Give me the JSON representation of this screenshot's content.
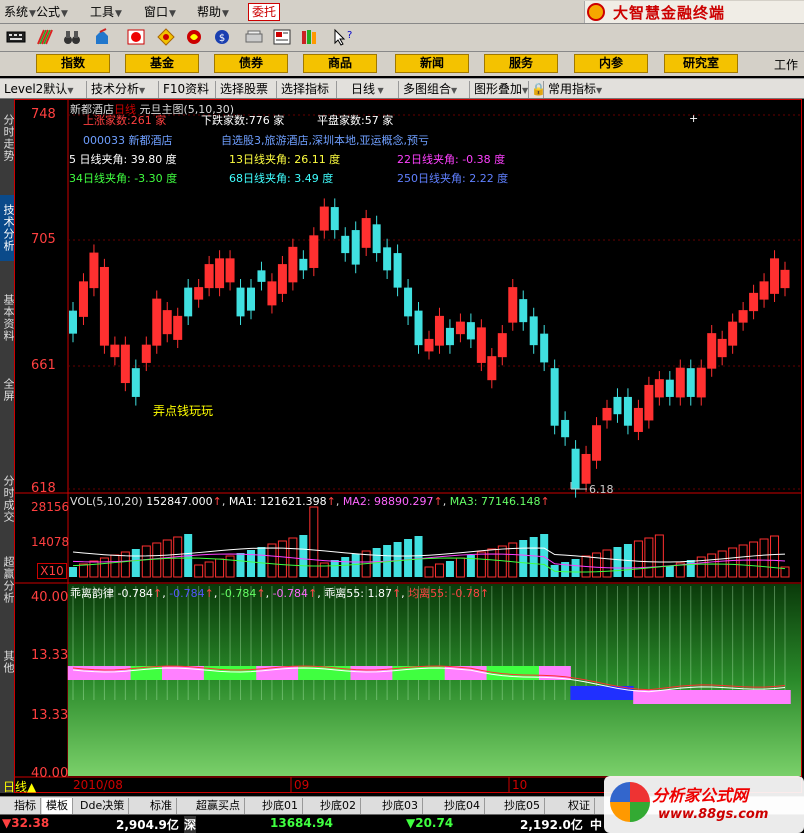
{
  "menubar": {
    "items": [
      "系统",
      "公式",
      "工具",
      "窗口",
      "帮助"
    ],
    "entrust": "委托",
    "brand": "大智慧金融终端"
  },
  "toolbar": {
    "icons": [
      "keyboard-icon",
      "stripes-icon",
      "binoculars-icon",
      "hand-icon",
      "alarm-icon",
      "diamond-icon",
      "swirl-icon",
      "dollar-icon",
      "scanner-icon",
      "news-icon",
      "books-icon",
      "help-pointer-icon"
    ]
  },
  "navbar": {
    "buttons": [
      "指数",
      "基金",
      "债券",
      "商品",
      "新闻",
      "服务",
      "内参",
      "研究室"
    ],
    "extra": "工作"
  },
  "chart_toolbar": {
    "items": [
      "Level2默认",
      "技术分析",
      "F10资料",
      "选择股票",
      "选择指标",
      "日线",
      "多图组合",
      "图形叠加",
      "常用指标"
    ]
  },
  "sidebar": {
    "tabs": [
      "分时走势",
      "技术分析",
      "基本资料",
      "全屏",
      "分时成交",
      "超赢分析",
      "其他"
    ]
  },
  "price_chart": {
    "title": "新都酒店",
    "period": "日线",
    "indicator": "元旦主图(5,10,30)",
    "up_count": "上涨家数:261 家",
    "down_count": "下跌家数:776 家",
    "flat_count": "平盘家数:57 家",
    "code_name": "000033 新都酒店",
    "tags": "自选股3,旅游酒店,深圳本地,亚运概念,预亏",
    "angles": [
      {
        "text": "5 日线夹角: 39.80 度",
        "color": "#ffffff"
      },
      {
        "text": "13日线夹角: 26.11 度",
        "color": "#ffff40"
      },
      {
        "text": "22日线夹角: -0.38 度",
        "color": "#ff40ff"
      },
      {
        "text": "34日线夹角: -3.30 度",
        "color": "#40ff40"
      },
      {
        "text": "68日线夹角: 3.49 度",
        "color": "#40ffff"
      },
      {
        "text": "250日线夹角: 2.22 度",
        "color": "#6080ff"
      }
    ],
    "note": "弄点钱玩玩",
    "low_mark": "6.18",
    "y_labels": [
      "748",
      "705",
      "661",
      "618"
    ]
  },
  "volume_chart": {
    "label": "VOL(5,10,20)",
    "vol": "152847.000",
    "ma1": "MA1: 121621.398",
    "ma2": "MA2: 98890.297",
    "ma3": "MA3: 77146.148",
    "y_labels": [
      "28156",
      "14078",
      "X10"
    ]
  },
  "indicator_chart": {
    "label": "乖离韵律",
    "v1": "-0.784",
    "v2": "-0.784",
    "v3": "-0.784",
    "v4": "-0.784",
    "v5": "乖离55: 1.87",
    "v6": "均离55: -0.78",
    "y_labels": [
      "40.00",
      "13.33",
      "13.33",
      "40.00"
    ]
  },
  "time_axis": {
    "labels": [
      "2010/08",
      "09",
      "10"
    ],
    "period_tab": "日线"
  },
  "bottom_tabs": [
    "指标",
    "模板",
    "Dde决策",
    "标准",
    "超赢买点",
    "抄底01",
    "抄底02",
    "抄底03",
    "抄底04",
    "抄底05",
    "权证"
  ],
  "status": {
    "s1": "32.38",
    "s2": "2,904.9亿",
    "s3": "深",
    "s4": "13684.94",
    "s5": "20.74",
    "s6": "2,192.0亿",
    "s7": "中"
  },
  "watermark": {
    "title": "分析家公式网",
    "url": "www.88gs.com"
  },
  "chart_data": {
    "type": "candlestick",
    "series": [
      {
        "o": 672,
        "c": 680,
        "up": false
      },
      {
        "o": 678,
        "c": 690,
        "up": true
      },
      {
        "o": 688,
        "c": 700,
        "up": true
      },
      {
        "o": 695,
        "c": 668,
        "up": true
      },
      {
        "o": 668,
        "c": 664,
        "up": true
      },
      {
        "o": 668,
        "c": 655,
        "up": true
      },
      {
        "o": 660,
        "c": 650,
        "up": false
      },
      {
        "o": 662,
        "c": 668,
        "up": true
      },
      {
        "o": 668,
        "c": 684,
        "up": true
      },
      {
        "o": 672,
        "c": 680,
        "up": true
      },
      {
        "o": 678,
        "c": 670,
        "up": true
      },
      {
        "o": 678,
        "c": 688,
        "up": false
      },
      {
        "o": 684,
        "c": 688,
        "up": true
      },
      {
        "o": 688,
        "c": 696,
        "up": true
      },
      {
        "o": 698,
        "c": 688,
        "up": true
      },
      {
        "o": 690,
        "c": 698,
        "up": true
      },
      {
        "o": 688,
        "c": 678,
        "up": false
      },
      {
        "o": 680,
        "c": 688,
        "up": false
      },
      {
        "o": 690,
        "c": 694,
        "up": false
      },
      {
        "o": 690,
        "c": 682,
        "up": true
      },
      {
        "o": 686,
        "c": 696,
        "up": true
      },
      {
        "o": 702,
        "c": 690,
        "up": true
      },
      {
        "o": 694,
        "c": 698,
        "up": false
      },
      {
        "o": 695,
        "c": 706,
        "up": true
      },
      {
        "o": 708,
        "c": 716,
        "up": true
      },
      {
        "o": 716,
        "c": 708,
        "up": false
      },
      {
        "o": 706,
        "c": 700,
        "up": false
      },
      {
        "o": 708,
        "c": 696,
        "up": false
      },
      {
        "o": 702,
        "c": 712,
        "up": true
      },
      {
        "o": 710,
        "c": 700,
        "up": false
      },
      {
        "o": 702,
        "c": 694,
        "up": false
      },
      {
        "o": 700,
        "c": 688,
        "up": false
      },
      {
        "o": 688,
        "c": 678,
        "up": false
      },
      {
        "o": 680,
        "c": 668,
        "up": false
      },
      {
        "o": 666,
        "c": 670,
        "up": true
      },
      {
        "o": 668,
        "c": 678,
        "up": true
      },
      {
        "o": 674,
        "c": 668,
        "up": false
      },
      {
        "o": 672,
        "c": 676,
        "up": true
      },
      {
        "o": 670,
        "c": 676,
        "up": false
      },
      {
        "o": 662,
        "c": 674,
        "up": true
      },
      {
        "o": 664,
        "c": 656,
        "up": true
      },
      {
        "o": 664,
        "c": 672,
        "up": true
      },
      {
        "o": 676,
        "c": 688,
        "up": true
      },
      {
        "o": 684,
        "c": 676,
        "up": false
      },
      {
        "o": 678,
        "c": 668,
        "up": false
      },
      {
        "o": 672,
        "c": 662,
        "up": false
      },
      {
        "o": 660,
        "c": 640,
        "up": false
      },
      {
        "o": 642,
        "c": 636,
        "up": false
      },
      {
        "o": 632,
        "c": 618,
        "up": false
      },
      {
        "o": 620,
        "c": 630,
        "up": true
      },
      {
        "o": 628,
        "c": 640,
        "up": true
      },
      {
        "o": 642,
        "c": 646,
        "up": true
      },
      {
        "o": 644,
        "c": 650,
        "up": false
      },
      {
        "o": 650,
        "c": 640,
        "up": false
      },
      {
        "o": 638,
        "c": 646,
        "up": true
      },
      {
        "o": 642,
        "c": 654,
        "up": true
      },
      {
        "o": 650,
        "c": 656,
        "up": true
      },
      {
        "o": 656,
        "c": 650,
        "up": false
      },
      {
        "o": 650,
        "c": 660,
        "up": true
      },
      {
        "o": 660,
        "c": 650,
        "up": false
      },
      {
        "o": 650,
        "c": 660,
        "up": true
      },
      {
        "o": 660,
        "c": 672,
        "up": true
      },
      {
        "o": 664,
        "c": 670,
        "up": true
      },
      {
        "o": 668,
        "c": 676,
        "up": true
      },
      {
        "o": 676,
        "c": 680,
        "up": true
      },
      {
        "o": 680,
        "c": 686,
        "up": true
      },
      {
        "o": 684,
        "c": 690,
        "up": true
      },
      {
        "o": 686,
        "c": 698,
        "up": true
      },
      {
        "o": 688,
        "c": 694,
        "up": true
      }
    ],
    "ylim": [
      618,
      748
    ]
  }
}
